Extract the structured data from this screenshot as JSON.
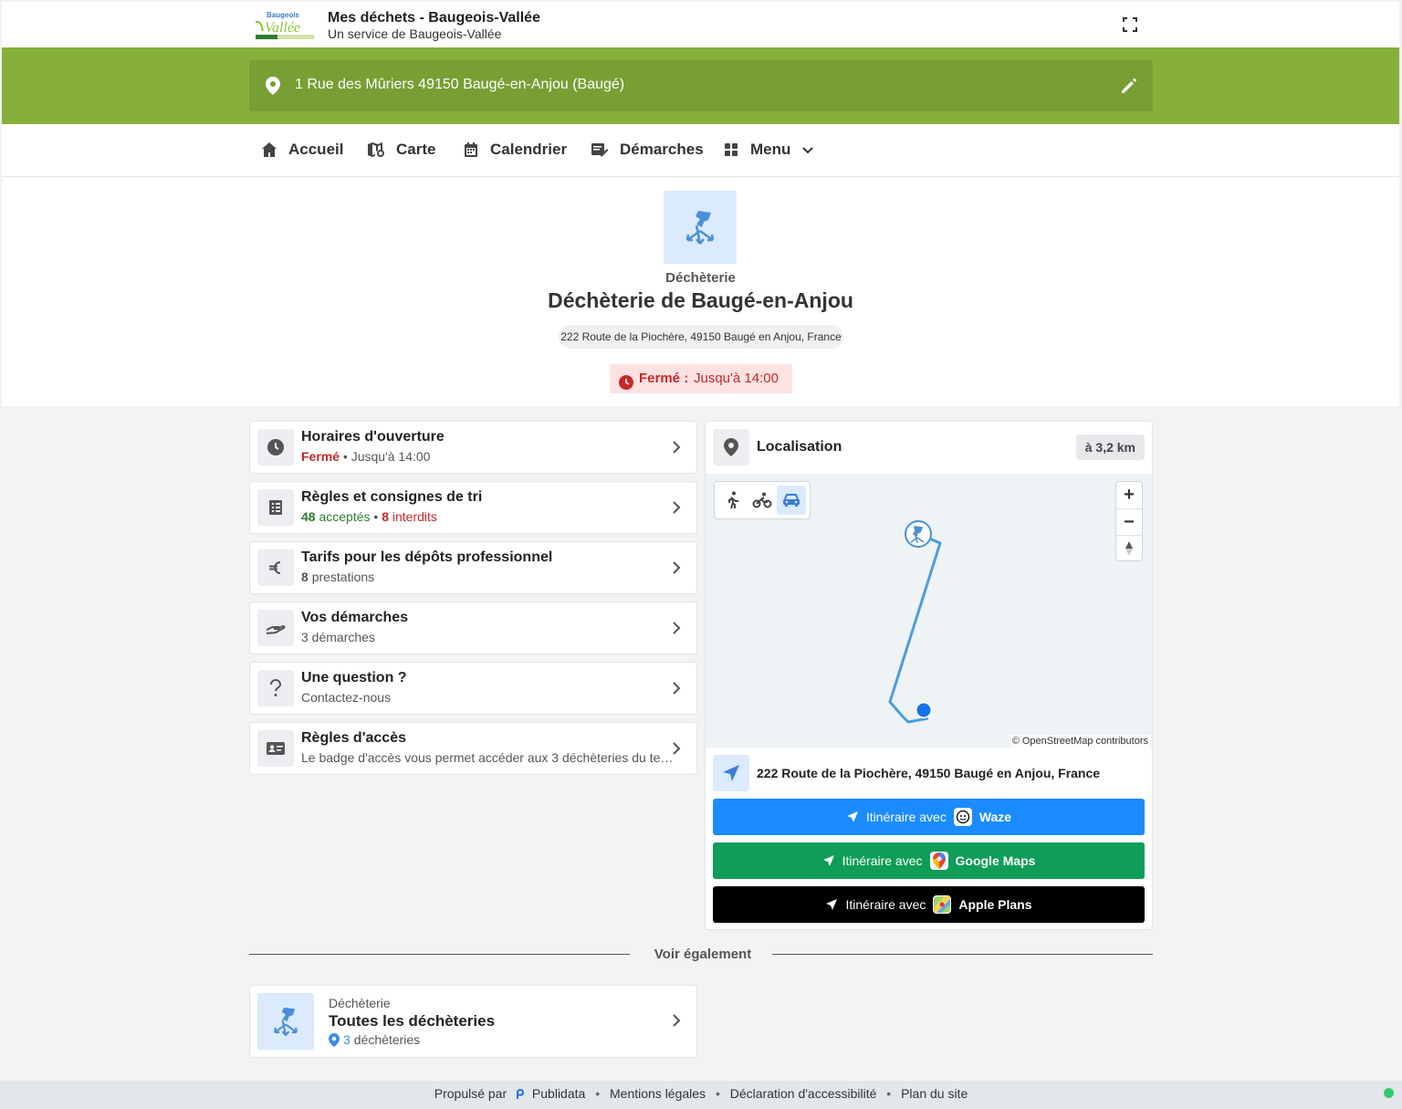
{
  "header": {
    "title": "Mes déchets - Baugeois-Vallée",
    "subtitle": "Un service de Baugeois-Vallée",
    "logo_text_top": "Baugeois",
    "logo_text_main": "Vallée"
  },
  "address_bar": {
    "address": "1 Rue des Mûriers 49150 Baugé-en-Anjou (Baugé)"
  },
  "nav": {
    "items": [
      {
        "label": "Accueil",
        "icon": "home-icon"
      },
      {
        "label": "Carte",
        "icon": "map-icon"
      },
      {
        "label": "Calendrier",
        "icon": "calendar-icon"
      },
      {
        "label": "Démarches",
        "icon": "form-icon"
      },
      {
        "label": "Menu",
        "icon": "grid-icon"
      }
    ]
  },
  "hero": {
    "category": "Déchèterie",
    "title": "Déchèterie de Baugé-en-Anjou",
    "address": "222 Route de la Piochère, 49150 Baugé en Anjou, France",
    "status_label": "Fermé :",
    "status_value": "Jusqu'à 14:00"
  },
  "cards": [
    {
      "title": "Horaires d'ouverture",
      "status": "Fermé",
      "sep": "•",
      "detail": "Jusqu'à 14:00",
      "icon": "clock-icon"
    },
    {
      "title": "Règles et consignes de tri",
      "accepted_count": "48",
      "accepted_label": "acceptés",
      "sep": "•",
      "forbidden_count": "8",
      "forbidden_label": "interdits",
      "icon": "checklist-icon"
    },
    {
      "title": "Tarifs pour les dépôts professionnel",
      "count": "8",
      "label": "prestations",
      "icon": "euro-icon"
    },
    {
      "title": "Vos démarches",
      "subtitle": "3 démarches",
      "icon": "hand-icon"
    },
    {
      "title": "Une question ?",
      "subtitle": "Contactez-nous",
      "icon": "question-icon"
    },
    {
      "title": "Règles d'accès",
      "subtitle": "Le badge d'accès vous permet accéder aux 3 déchèteries du te…",
      "icon": "id-card-icon"
    }
  ],
  "location": {
    "title": "Localisation",
    "distance": "à 3,2 km",
    "attribution": "© OpenStreetMap contributors",
    "destination": "222 Route de la Piochère, 49150 Baugé en Anjou, France",
    "zoom_in": "+",
    "zoom_out": "−",
    "route_prefix": "Itinéraire avec",
    "routes": [
      {
        "brand": "Waze",
        "color": "#1a8cff"
      },
      {
        "brand": "Google Maps",
        "color": "#0f9d58"
      },
      {
        "brand": "Apple Plans",
        "color": "#000000"
      }
    ]
  },
  "see_also": {
    "heading": "Voir également",
    "category": "Déchèterie",
    "title": "Toutes les déchèteries",
    "count": "3",
    "label": "déchèteries"
  },
  "footer": {
    "powered_prefix": "Propulsé par",
    "powered_brand": "Publidata",
    "links": [
      "Mentions légales",
      "Déclaration d'accessibilité",
      "Plan du site"
    ]
  },
  "colors": {
    "accent_green": "#86b03a",
    "closed_red": "#c62828",
    "primary_blue": "#1a8cff"
  }
}
